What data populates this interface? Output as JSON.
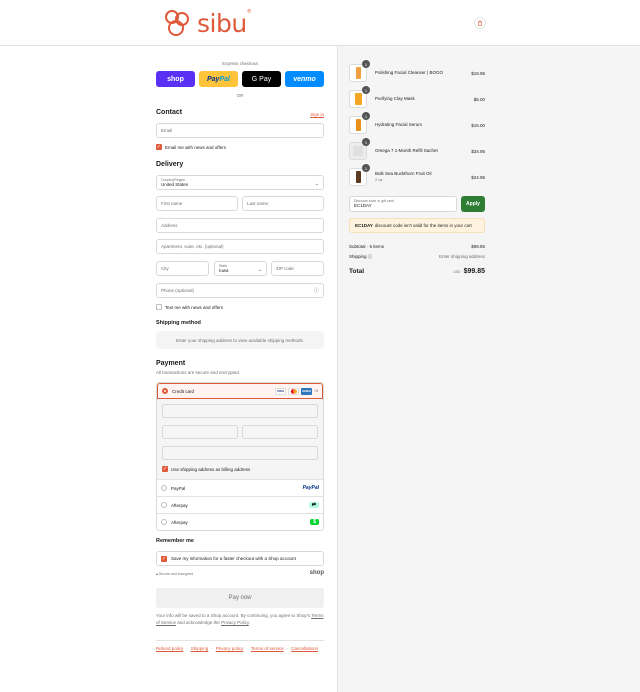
{
  "brand": {
    "name": "sibu",
    "reg": "®"
  },
  "express": {
    "label": "Express checkout",
    "shop": "shop",
    "paypal_a": "Pay",
    "paypal_b": "Pal",
    "gpay": "G Pay",
    "venmo": "venmo",
    "or": "OR"
  },
  "contact": {
    "title": "Contact",
    "sign_in": "Sign in",
    "email_placeholder": "Email",
    "news_label": "Email me with news and offers"
  },
  "delivery": {
    "title": "Delivery",
    "country_label": "Country/Region",
    "country_value": "United States",
    "first_name": "First name",
    "last_name": "Last name",
    "address": "Address",
    "apartment": "Apartment, suite, etc. (optional)",
    "city": "City",
    "state_label": "State",
    "state_value": "Iowa",
    "zip": "ZIP code",
    "phone": "Phone (optional)",
    "text_label": "Text me with news and offers"
  },
  "shipping_method": {
    "title": "Shipping method",
    "message": "Enter your shipping address to view available shipping methods."
  },
  "payment": {
    "title": "Payment",
    "subtitle": "All transactions are secure and encrypted.",
    "credit_card": "Credit card",
    "card_visa": "VISA",
    "card_amex": "AMEX",
    "card_more": "+4",
    "billing_label": "Use shipping address as billing address",
    "options": [
      {
        "label": "PayPal",
        "logo": "PayPal",
        "color": "#003087"
      },
      {
        "label": "Afterpay",
        "logo": "⇄",
        "color": "#b2fce4"
      },
      {
        "label": "Afterpay",
        "logo": "$",
        "color": "#00d632"
      }
    ]
  },
  "remember": {
    "title": "Remember me",
    "label": "Save my information for a faster checkout with a Shop account",
    "secure": "Secure and encrypted",
    "shop": "shop"
  },
  "pay_now": "Pay now",
  "disclaimer": {
    "text_a": "Your info will be saved to a Shop account. By continuing, you agree to Shop's",
    "tos": "Terms of Service",
    "text_b": "and acknowledge the",
    "privacy": "Privacy Policy",
    "text_c": "."
  },
  "footer": [
    "Refund policy",
    "Shipping",
    "Privacy policy",
    "Terms of service",
    "Cancellations"
  ],
  "order": {
    "items": [
      {
        "name": "Polishing Facial Cleanser | BOGO",
        "variant": "",
        "price": "$19.95",
        "qty": "1",
        "color": "#f0a040"
      },
      {
        "name": "Purifying Clay Mask",
        "variant": "",
        "price": "$5.00",
        "qty": "1",
        "color": "#f5a623"
      },
      {
        "name": "Hydrating Facial Serum",
        "variant": "",
        "price": "$15.00",
        "qty": "1",
        "color": "#e8901c"
      },
      {
        "name": "Omega 7 1-Month Refill Sachet",
        "variant": "",
        "price": "$34.95",
        "qty": "1",
        "color": "#e0e0e0"
      },
      {
        "name": "Bulk Sea Buckthorn Fruit Oil",
        "variant": "2 oz",
        "price": "$24.95",
        "qty": "1",
        "color": "#5a3a20"
      }
    ],
    "discount_label": "Discount code or gift card",
    "discount_value": "EC1DAY",
    "apply": "Apply",
    "error_code": "EC1DAY",
    "error_text": "discount code isn't valid for the items in your cart",
    "subtotal_label": "Subtotal · 5 items",
    "subtotal_value": "$99.85",
    "shipping_label": "Shipping",
    "shipping_value": "Enter shipping address",
    "total_label": "Total",
    "currency": "USD",
    "total_value": "$99.85"
  }
}
